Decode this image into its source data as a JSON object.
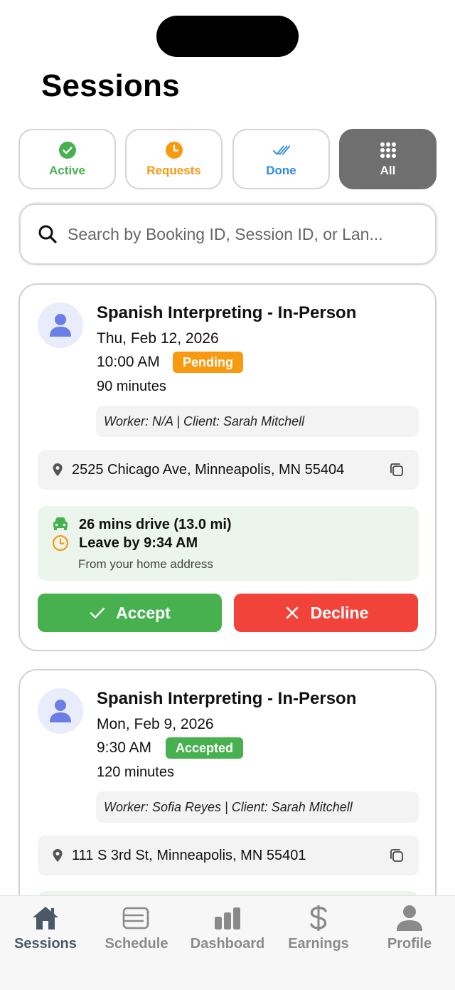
{
  "page": {
    "title": "Sessions"
  },
  "filters": [
    {
      "label": "Active",
      "icon": "check-circle-icon",
      "color": "#47b14f"
    },
    {
      "label": "Requests",
      "icon": "clock-icon",
      "color": "#f79a10"
    },
    {
      "label": "Done",
      "icon": "double-check-icon",
      "color": "#2e8be0"
    },
    {
      "label": "All",
      "icon": "grid-icon",
      "color": "#ffffff",
      "selected": true
    }
  ],
  "search": {
    "placeholder": "Search by Booking ID, Session ID, or Lan..."
  },
  "sessions": [
    {
      "title": "Spanish Interpreting - In-Person",
      "date": "Thu, Feb 12, 2026",
      "time": "10:00 AM",
      "status": "Pending",
      "duration": "90 minutes",
      "people": "Worker: N/A | Client: Sarah Mitchell",
      "address": "2525 Chicago Ave, Minneapolis, MN 55404",
      "drive": "26 mins drive (13.0 mi)",
      "leave_by": "Leave by 9:34 AM",
      "drive_note": "From your home address",
      "accept_label": "Accept",
      "decline_label": "Decline"
    },
    {
      "title": "Spanish Interpreting - In-Person",
      "date": "Mon, Feb 9, 2026",
      "time": "9:30 AM",
      "status": "Accepted",
      "duration": "120 minutes",
      "people": "Worker: Sofia Reyes | Client: Sarah Mitchell",
      "address": "111 S 3rd St, Minneapolis, MN 55401"
    }
  ],
  "tabbar": [
    {
      "label": "Sessions",
      "icon": "home-icon",
      "selected": true
    },
    {
      "label": "Schedule",
      "icon": "schedule-icon"
    },
    {
      "label": "Dashboard",
      "icon": "bar-chart-icon"
    },
    {
      "label": "Earnings",
      "icon": "dollar-icon"
    },
    {
      "label": "Profile",
      "icon": "person-icon"
    }
  ],
  "colors": {
    "accent_green": "#47b14f",
    "accent_orange": "#f79a10",
    "accent_blue": "#2e8be0",
    "decline_red": "#f2433a",
    "avatar_blue": "#6b7ee8"
  }
}
